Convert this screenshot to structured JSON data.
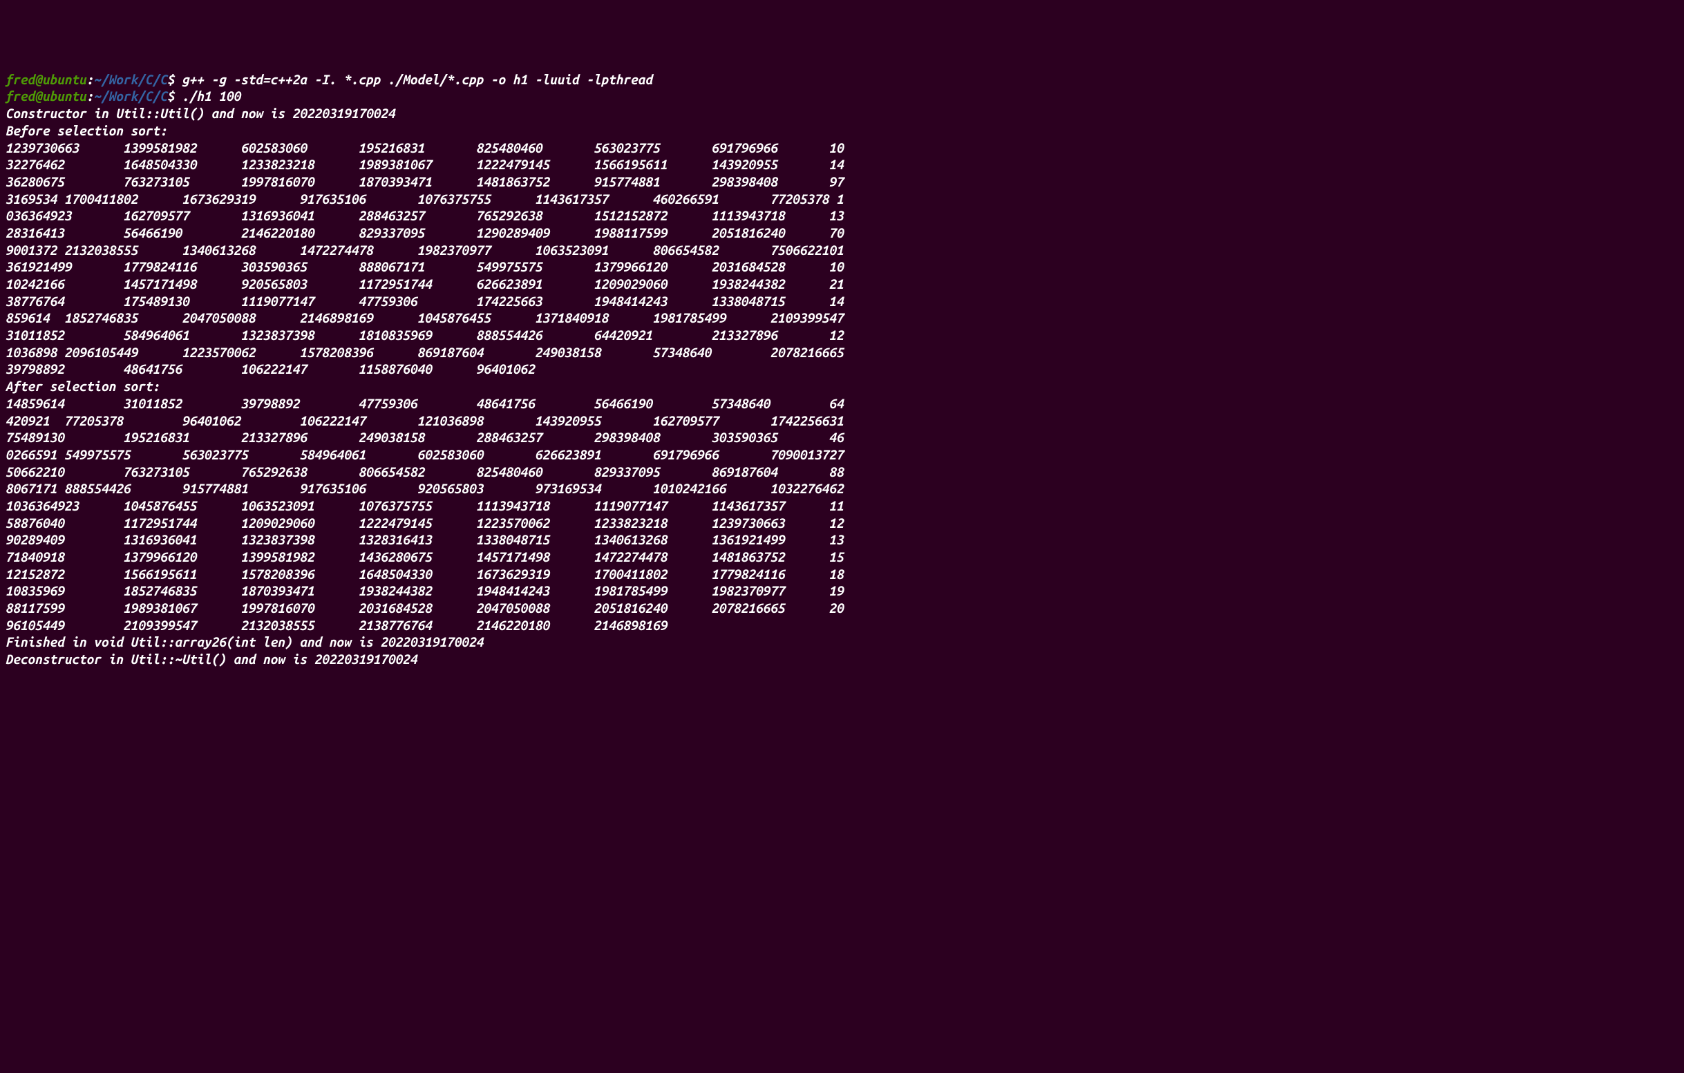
{
  "prompt": {
    "user": "fred@ubuntu",
    "colon": ":",
    "path": "~/Work/C/C",
    "dollar": "$ "
  },
  "commands": {
    "compile": "g++ -g -std=c++2a -I. *.cpp ./Model/*.cpp -o h1 -luuid -lpthread",
    "run": "./h1 100"
  },
  "output": {
    "constructor": "Constructor in Util::Util() and now is 20220319170024",
    "before_label": "Before selection sort:",
    "before_lines": [
      "1239730663      1399581982      602583060       195216831       825480460       563023775       691796966       10",
      "32276462        1648504330      1233823218      1989381067      1222479145      1566195611      143920955       14",
      "36280675        763273105       1997816070      1870393471      1481863752      915774881       298398408       97",
      "3169534 1700411802      1673629319      917635106       1076375755      1143617357      460266591       77205378 1",
      "036364923       162709577       1316936041      288463257       765292638       1512152872      1113943718      13",
      "28316413        56466190        2146220180      829337095       1290289409      1988117599      2051816240      70",
      "9001372 2132038555      1340613268      1472274478      1982370977      1063523091      806654582       7506622101",
      "361921499       1779824116      303590365       888067171       549975575       1379966120      2031684528      10",
      "10242166        1457171498      920565803       1172951744      626623891       1209029060      1938244382      21",
      "38776764        175489130       1119077147      47759306        174225663       1948414243      1338048715      14",
      "859614  1852746835      2047050088      2146898169      1045876455      1371840918      1981785499      2109399547",
      "31011852        584964061       1323837398      1810835969      888554426       64420921        213327896       12",
      "1036898 2096105449      1223570062      1578208396      869187604       249038158       57348640        2078216665",
      "39798892        48641756        106222147       1158876040      96401062"
    ],
    "blank": "",
    "after_label": "After selection sort:",
    "after_lines": [
      "14859614        31011852        39798892        47759306        48641756        56466190        57348640        64",
      "420921  77205378        96401062        106222147       121036898       143920955       162709577       1742256631",
      "75489130        195216831       213327896       249038158       288463257       298398408       303590365       46",
      "0266591 549975575       563023775       584964061       602583060       626623891       691796966       7090013727",
      "50662210        763273105       765292638       806654582       825480460       829337095       869187604       88",
      "8067171 888554426       915774881       917635106       920565803       973169534       1010242166      1032276462",
      "1036364923      1045876455      1063523091      1076375755      1113943718      1119077147      1143617357      11",
      "58876040        1172951744      1209029060      1222479145      1223570062      1233823218      1239730663      12",
      "90289409        1316936041      1323837398      1328316413      1338048715      1340613268      1361921499      13",
      "71840918        1379966120      1399581982      1436280675      1457171498      1472274478      1481863752      15",
      "12152872        1566195611      1578208396      1648504330      1673629319      1700411802      1779824116      18",
      "10835969        1852746835      1870393471      1938244382      1948414243      1981785499      1982370977      19",
      "88117599        1989381067      1997816070      2031684528      2047050088      2051816240      2078216665      20",
      "96105449        2109399547      2132038555      2138776764      2146220180      2146898169"
    ],
    "finished": "Finished in void Util::array26(int len) and now is 20220319170024",
    "deconstructor": "Deconstructor in Util::~Util() and now is 20220319170024"
  }
}
